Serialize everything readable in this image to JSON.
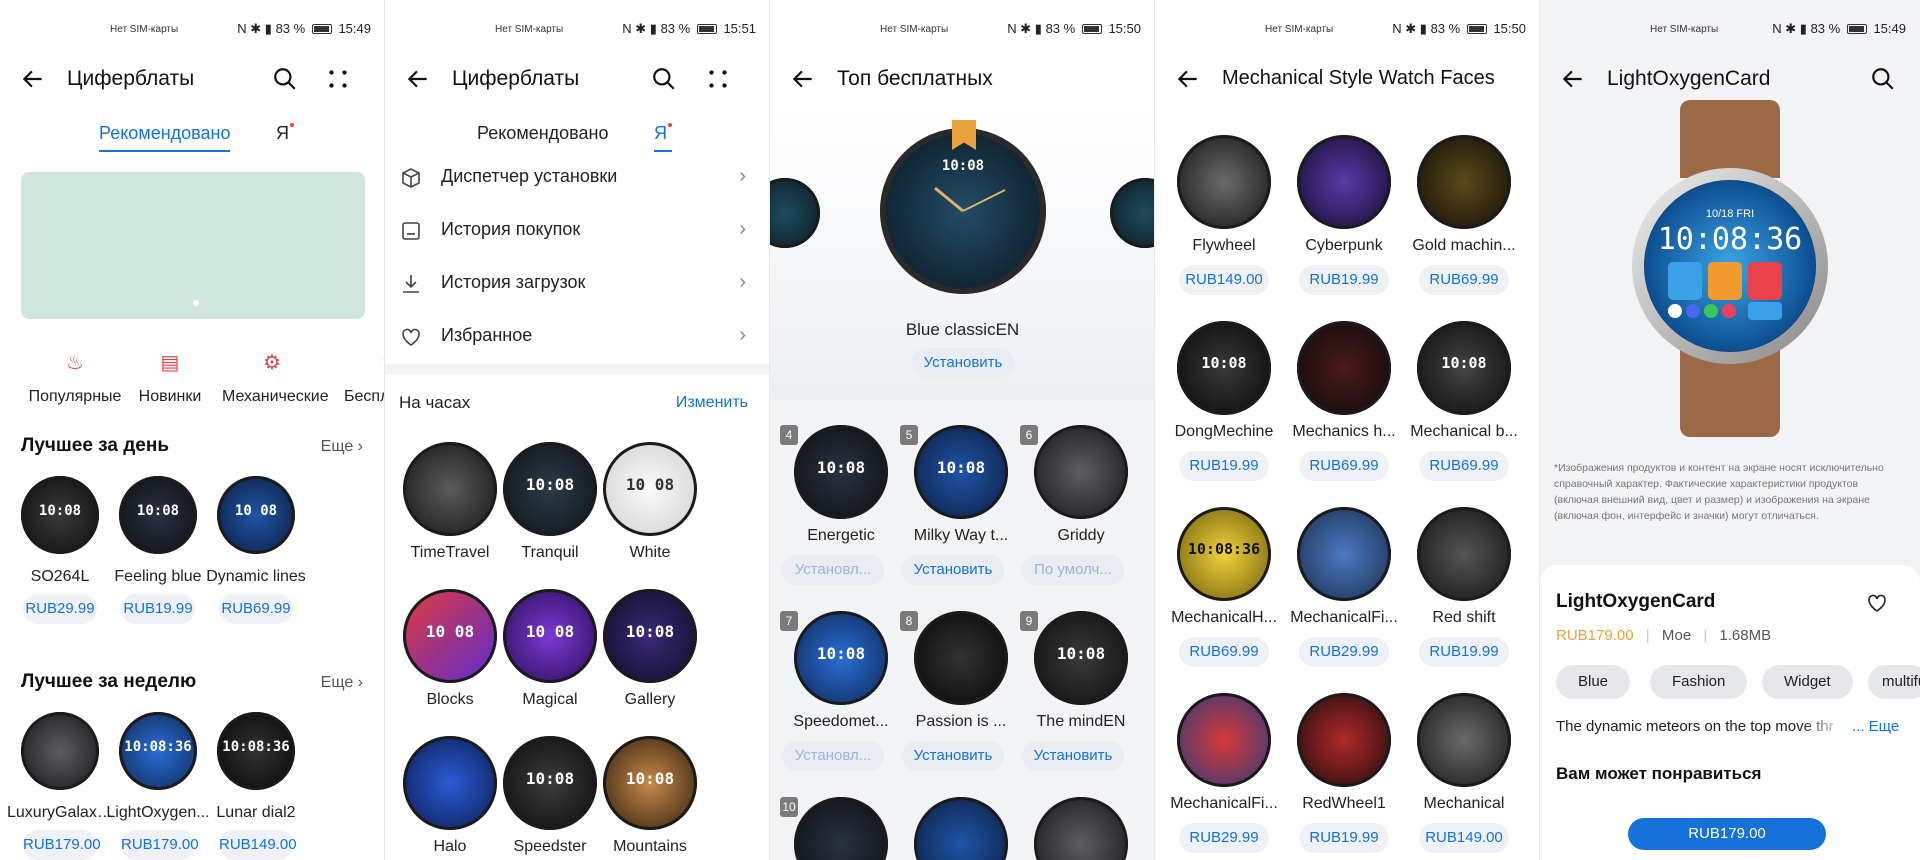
{
  "screens": [
    {
      "status": {
        "sim": "Нет SIM-карты",
        "battery": "83 %",
        "time": "15:49"
      },
      "title": "Циферблаты",
      "tabs": [
        {
          "label": "Рекомендовано"
        },
        {
          "label": "Я"
        }
      ],
      "categories": [
        {
          "label": "Популярные",
          "icon": "popular-icon"
        },
        {
          "label": "Новинки",
          "icon": "new-icon"
        },
        {
          "label": "Механические",
          "icon": "mechanical-icon"
        },
        {
          "label": "Беспл",
          "icon": "free-icon"
        }
      ],
      "best_day": {
        "title": "Лучшее за день",
        "more": "Еще",
        "items": [
          {
            "name": "SO264L",
            "price": "RUB29.99",
            "face": "10:08"
          },
          {
            "name": "Feeling blue",
            "price": "RUB19.99",
            "face": "10:08"
          },
          {
            "name": "Dynamic lines",
            "price": "RUB69.99",
            "face": "10 08"
          }
        ]
      },
      "best_week": {
        "title": "Лучшее за неделю",
        "more": "Еще",
        "items": [
          {
            "name": "LuxuryGalaxy...",
            "price": "RUB179.00",
            "face": ""
          },
          {
            "name": "LightOxygen...",
            "price": "RUB179.00",
            "face": "10:08:36"
          },
          {
            "name": "Lunar dial2",
            "price": "RUB149.00",
            "face": "10:08:36"
          }
        ]
      }
    },
    {
      "status": {
        "sim": "Нет SIM-карты",
        "battery": "83 %",
        "time": "15:51"
      },
      "title": "Циферблаты",
      "tabs": [
        {
          "label": "Рекомендовано"
        },
        {
          "label": "Я"
        }
      ],
      "menu": [
        {
          "label": "Диспетчер установки",
          "icon": "install-manager-icon"
        },
        {
          "label": "История покупок",
          "icon": "purchase-history-icon"
        },
        {
          "label": "История загрузок",
          "icon": "download-history-icon"
        },
        {
          "label": "Избранное",
          "icon": "heart-icon"
        }
      ],
      "on_watch": {
        "title": "На часах",
        "edit": "Изменить"
      },
      "faces": [
        {
          "name": "TimeTravel",
          "face": ""
        },
        {
          "name": "Tranquil",
          "face": "10:08"
        },
        {
          "name": "White",
          "face": "10 08"
        },
        {
          "name": "Blocks",
          "face": "10 08"
        },
        {
          "name": "Magical",
          "face": "10 08"
        },
        {
          "name": "Gallery",
          "face": "10:08"
        },
        {
          "name": "Halo",
          "face": ""
        },
        {
          "name": "Speedster",
          "face": "10:08"
        },
        {
          "name": "Mountains",
          "face": "10:08"
        }
      ]
    },
    {
      "status": {
        "sim": "Нет SIM-карты",
        "battery": "83 %",
        "time": "15:50"
      },
      "title": "Топ бесплатных",
      "hero": {
        "name": "Blue classicEN",
        "action": "Установить",
        "face": "10:08"
      },
      "items": [
        {
          "rank": "4",
          "name": "Energetic",
          "action": "Установл...",
          "disabled": true,
          "face": "10:08"
        },
        {
          "rank": "5",
          "name": "Milky Way t...",
          "action": "Установить",
          "disabled": false,
          "face": "10:08"
        },
        {
          "rank": "6",
          "name": "Griddy",
          "action": "По умолч...",
          "disabled": true,
          "face": ""
        },
        {
          "rank": "7",
          "name": "Speedomet...",
          "action": "Установл...",
          "disabled": true,
          "face": "10:08"
        },
        {
          "rank": "8",
          "name": "Passion is ...",
          "action": "Установить",
          "disabled": false,
          "face": ""
        },
        {
          "rank": "9",
          "name": "The mindEN",
          "action": "Установить",
          "disabled": false,
          "face": "10:08"
        },
        {
          "rank": "10",
          "name": "",
          "action": "",
          "disabled": false,
          "face": ""
        },
        {
          "rank": "",
          "name": "",
          "action": "",
          "disabled": false,
          "face": ""
        },
        {
          "rank": "",
          "name": "",
          "action": "",
          "disabled": false,
          "face": ""
        }
      ]
    },
    {
      "status": {
        "sim": "Нет SIM-карты",
        "battery": "83 %",
        "time": "15:50"
      },
      "title": "Mechanical Style Watch Faces",
      "items": [
        {
          "name": "Flywheel",
          "price": "RUB149.00",
          "face": ""
        },
        {
          "name": "Cyberpunk",
          "price": "RUB19.99",
          "face": ""
        },
        {
          "name": "Gold machin...",
          "price": "RUB69.99",
          "face": ""
        },
        {
          "name": "DongMechine",
          "price": "RUB19.99",
          "face": "10:08"
        },
        {
          "name": "Mechanics h...",
          "price": "RUB69.99",
          "face": ""
        },
        {
          "name": "Mechanical b...",
          "price": "RUB69.99",
          "face": "10:08"
        },
        {
          "name": "MechanicalH...",
          "price": "RUB69.99",
          "face": "10:08:36"
        },
        {
          "name": "MechanicalFi...",
          "price": "RUB29.99",
          "face": ""
        },
        {
          "name": "Red shift",
          "price": "RUB19.99",
          "face": ""
        },
        {
          "name": "MechanicalFi...",
          "price": "RUB29.99",
          "face": ""
        },
        {
          "name": "RedWheel1",
          "price": "RUB19.99",
          "face": ""
        },
        {
          "name": "Mechanical",
          "price": "RUB149.00",
          "face": ""
        }
      ]
    },
    {
      "status": {
        "sim": "Нет SIM-карты",
        "battery": "83 %",
        "time": "15:49"
      },
      "title": "LightOxygenCard",
      "watch_time": "10:08:36",
      "watch_date": "10/18 FRI",
      "disclaimer": "*Изображения продуктов и контент на экране носят исключительно справочный характер. Фактические характеристики продуктов (включая внешний вид, цвет и размер) и изображения на экране (включая фон, интерфейс и значки) могут отличаться.",
      "product": {
        "name": "LightOxygenCard",
        "price": "RUB179.00",
        "owner": "Мое",
        "size": "1.68MB"
      },
      "tags": [
        "Blue",
        "Fashion",
        "Widget",
        "multifunctio"
      ],
      "description": "The dynamic meteors on the top move thr",
      "more": "... Еще",
      "recommend": "Вам может понравиться",
      "buy": "RUB179.00"
    }
  ],
  "colors": {
    "accent": "#1472d9",
    "red": "#e04545",
    "banner": "#cfe6dc",
    "gold": "#e9a23b"
  }
}
